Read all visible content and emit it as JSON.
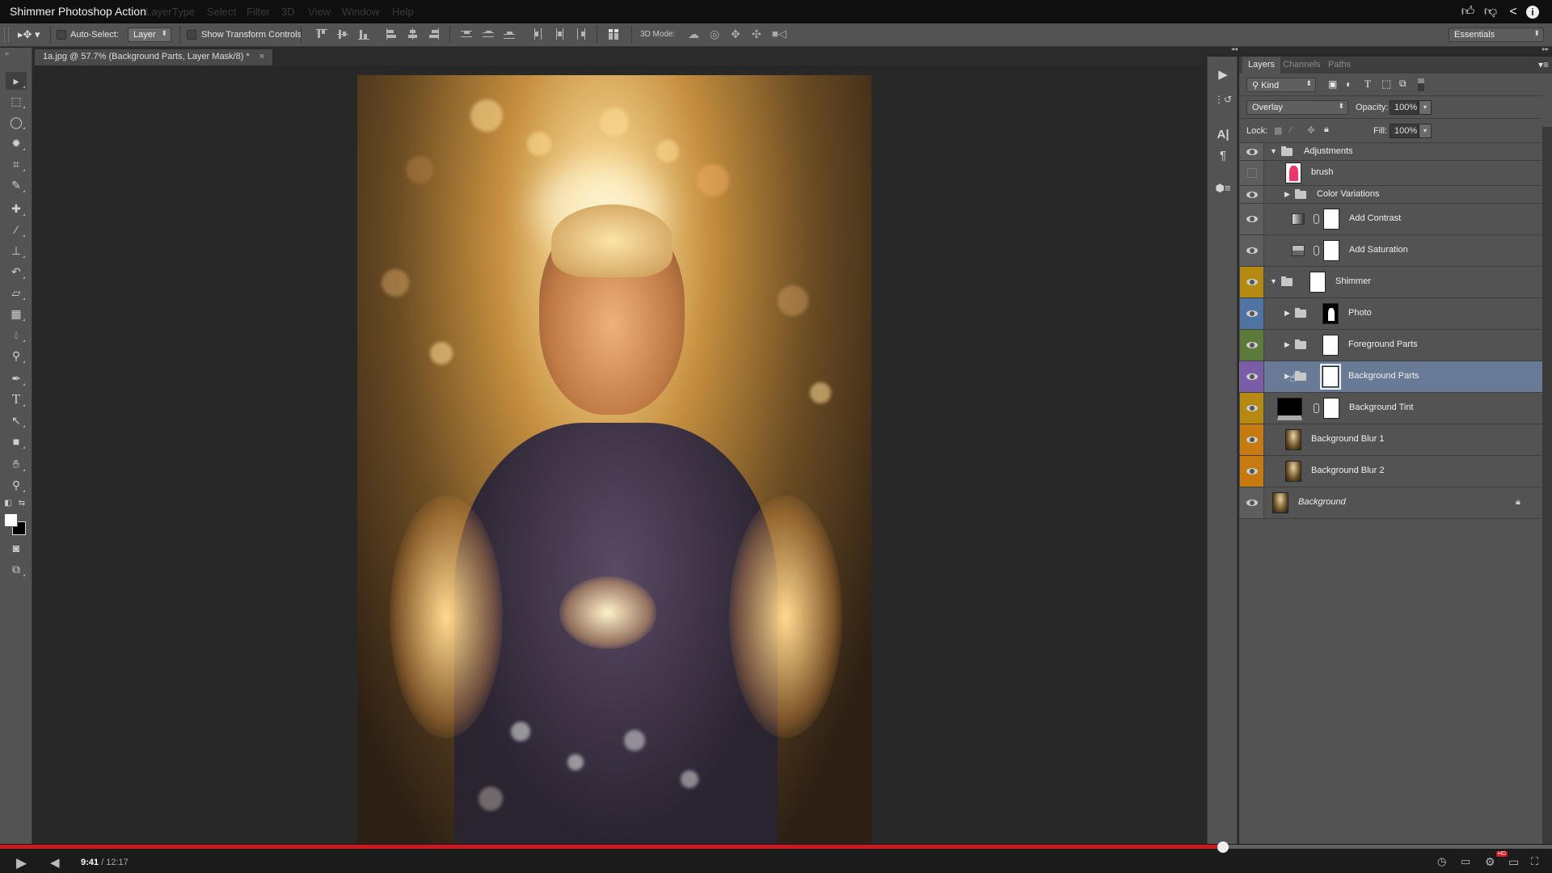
{
  "window": {
    "title": "Shimmer Photoshop Action",
    "menu": [
      "Layer",
      "Type",
      "Select",
      "Filter",
      "3D",
      "View",
      "Window",
      "Help"
    ],
    "video_actions": [
      "like-icon",
      "dislike-icon",
      "share-icon",
      "info-icon"
    ]
  },
  "options_bar": {
    "auto_select_label": "Auto-Select:",
    "auto_select_checked": false,
    "auto_select_target": "Layer",
    "show_transform_label": "Show Transform Controls",
    "show_transform_checked": false,
    "mode_3d_label": "3D Mode:",
    "workspace": "Essentials"
  },
  "document_tab": {
    "title": "1a.jpg @ 57.7% (Background Parts, Layer Mask/8) *",
    "close": "×"
  },
  "tools": [
    "move",
    "rectangular-marquee",
    "lasso",
    "magic-wand",
    "crop",
    "eyedropper",
    "spot-healing-brush",
    "brush",
    "clone-stamp",
    "history-brush",
    "eraser",
    "gradient",
    "blur",
    "dodge",
    "pen",
    "type",
    "path-selection",
    "rectangle",
    "hand",
    "zoom",
    "swap-colors",
    "default-colors",
    "quick-mask",
    "screen-mode"
  ],
  "colors": {
    "foreground": "#ffffff",
    "background": "#000000",
    "progress_red": "#cc181e",
    "selected_layer": "#687a95"
  },
  "layers_panel": {
    "tabs": [
      "Layers",
      "Channels",
      "Paths"
    ],
    "active_tab": "Layers",
    "filter_kind": "Kind",
    "blend_mode": "Overlay",
    "opacity_label": "Opacity:",
    "opacity": "100%",
    "lock_label": "Lock:",
    "fill_label": "Fill:",
    "fill": "100%",
    "layers": [
      {
        "name": "Adjustments",
        "type": "group",
        "expanded": true,
        "visible": true,
        "color": ""
      },
      {
        "name": "brush",
        "type": "pixel",
        "visible": false,
        "color": ""
      },
      {
        "name": "Color Variations",
        "type": "group",
        "expanded": false,
        "visible": true,
        "color": ""
      },
      {
        "name": "Add Contrast",
        "type": "adjustment",
        "visible": true,
        "color": ""
      },
      {
        "name": "Add Saturation",
        "type": "adjustment",
        "visible": true,
        "color": ""
      },
      {
        "name": "Shimmer",
        "type": "group",
        "expanded": true,
        "visible": true,
        "color": "#b58a10"
      },
      {
        "name": "Photo",
        "type": "group",
        "expanded": false,
        "visible": true,
        "color": "#4f73a3"
      },
      {
        "name": "Foreground Parts",
        "type": "group",
        "expanded": false,
        "visible": true,
        "color": "#5c7a3a"
      },
      {
        "name": "Background Parts",
        "type": "group",
        "expanded": false,
        "visible": true,
        "color": "#7a5ca8",
        "selected": true
      },
      {
        "name": "Background Tint",
        "type": "fill",
        "visible": true,
        "color": "#b58a10"
      },
      {
        "name": "Background Blur 1",
        "type": "pixel",
        "visible": true,
        "color": "#c77a10"
      },
      {
        "name": "Background Blur 2",
        "type": "pixel",
        "visible": true,
        "color": "#c77a10"
      },
      {
        "name": "Background",
        "type": "background",
        "visible": true,
        "color": "",
        "locked": true
      }
    ]
  },
  "video_player": {
    "current_time": "9:41",
    "separator": " / ",
    "duration": "12:17",
    "progress": 0.788,
    "hd_badge": "HD"
  }
}
